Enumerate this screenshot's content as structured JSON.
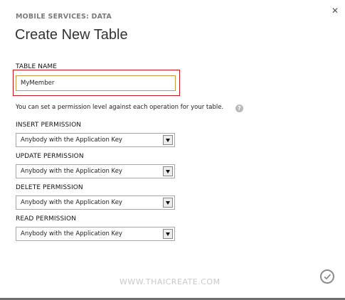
{
  "dialog": {
    "eyebrow": "MOBILE SERVICES: DATA",
    "title": "Create New Table",
    "close_icon": "close-icon",
    "confirm_icon": "checkmark-icon"
  },
  "table_name": {
    "label": "TABLE NAME",
    "value": "MyMember"
  },
  "help": {
    "text": "You can set a permission level against each operation for your table.",
    "icon": "help-icon"
  },
  "permissions": {
    "insert": {
      "label": "INSERT PERMISSION",
      "value": "Anybody with the Application Key"
    },
    "update": {
      "label": "UPDATE PERMISSION",
      "value": "Anybody with the Application Key"
    },
    "delete": {
      "label": "DELETE PERMISSION",
      "value": "Anybody with the Application Key"
    },
    "read": {
      "label": "READ PERMISSION",
      "value": "Anybody with the Application Key"
    }
  },
  "watermark": "WWW.THAICREATE.COM",
  "colors": {
    "focus_frame": "#c8141e",
    "input_border": "#c39a3c",
    "bottom_bar": "#6e6e6e"
  }
}
